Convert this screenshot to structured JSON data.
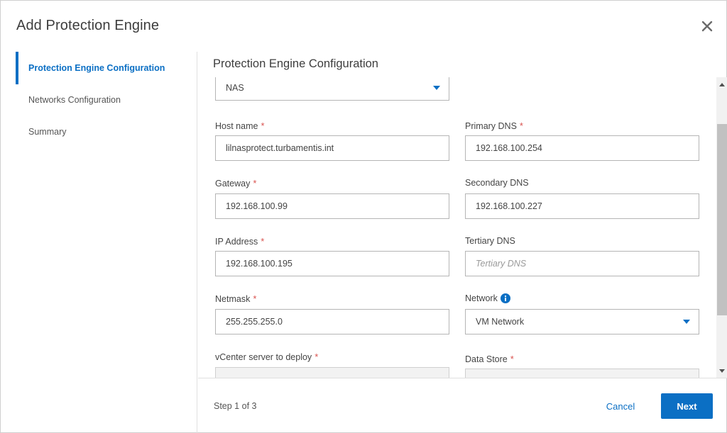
{
  "dialog": {
    "title": "Add Protection Engine",
    "close_icon": "close-icon"
  },
  "nav": {
    "items": [
      {
        "label": "Protection Engine Configuration",
        "active": true
      },
      {
        "label": "Networks Configuration",
        "active": false
      },
      {
        "label": "Summary",
        "active": false
      }
    ]
  },
  "main": {
    "title": "Protection Engine Configuration"
  },
  "form": {
    "type_select": {
      "value": "NAS"
    },
    "host_name": {
      "label": "Host name",
      "required": "*",
      "value": "lilnasprotect.turbamentis.int"
    },
    "primary_dns": {
      "label": "Primary DNS",
      "required": "*",
      "value": "192.168.100.254"
    },
    "gateway": {
      "label": "Gateway",
      "required": "*",
      "value": "192.168.100.99"
    },
    "secondary_dns": {
      "label": "Secondary DNS",
      "value": "192.168.100.227"
    },
    "ip_address": {
      "label": "IP Address",
      "required": "*",
      "value": "192.168.100.195"
    },
    "tertiary_dns": {
      "label": "Tertiary DNS",
      "placeholder": "Tertiary DNS",
      "value": ""
    },
    "netmask": {
      "label": "Netmask",
      "required": "*",
      "value": "255.255.255.0"
    },
    "network": {
      "label": "Network",
      "info_icon": "info-icon",
      "value": "VM Network"
    },
    "vcenter": {
      "label": "vCenter server to deploy",
      "required": "*"
    },
    "data_store": {
      "label": "Data Store",
      "required": "*"
    }
  },
  "footer": {
    "step": "Step 1 of 3",
    "cancel_label": "Cancel",
    "next_label": "Next"
  },
  "colors": {
    "accent": "#0b6fc4",
    "required": "#d9534f"
  }
}
